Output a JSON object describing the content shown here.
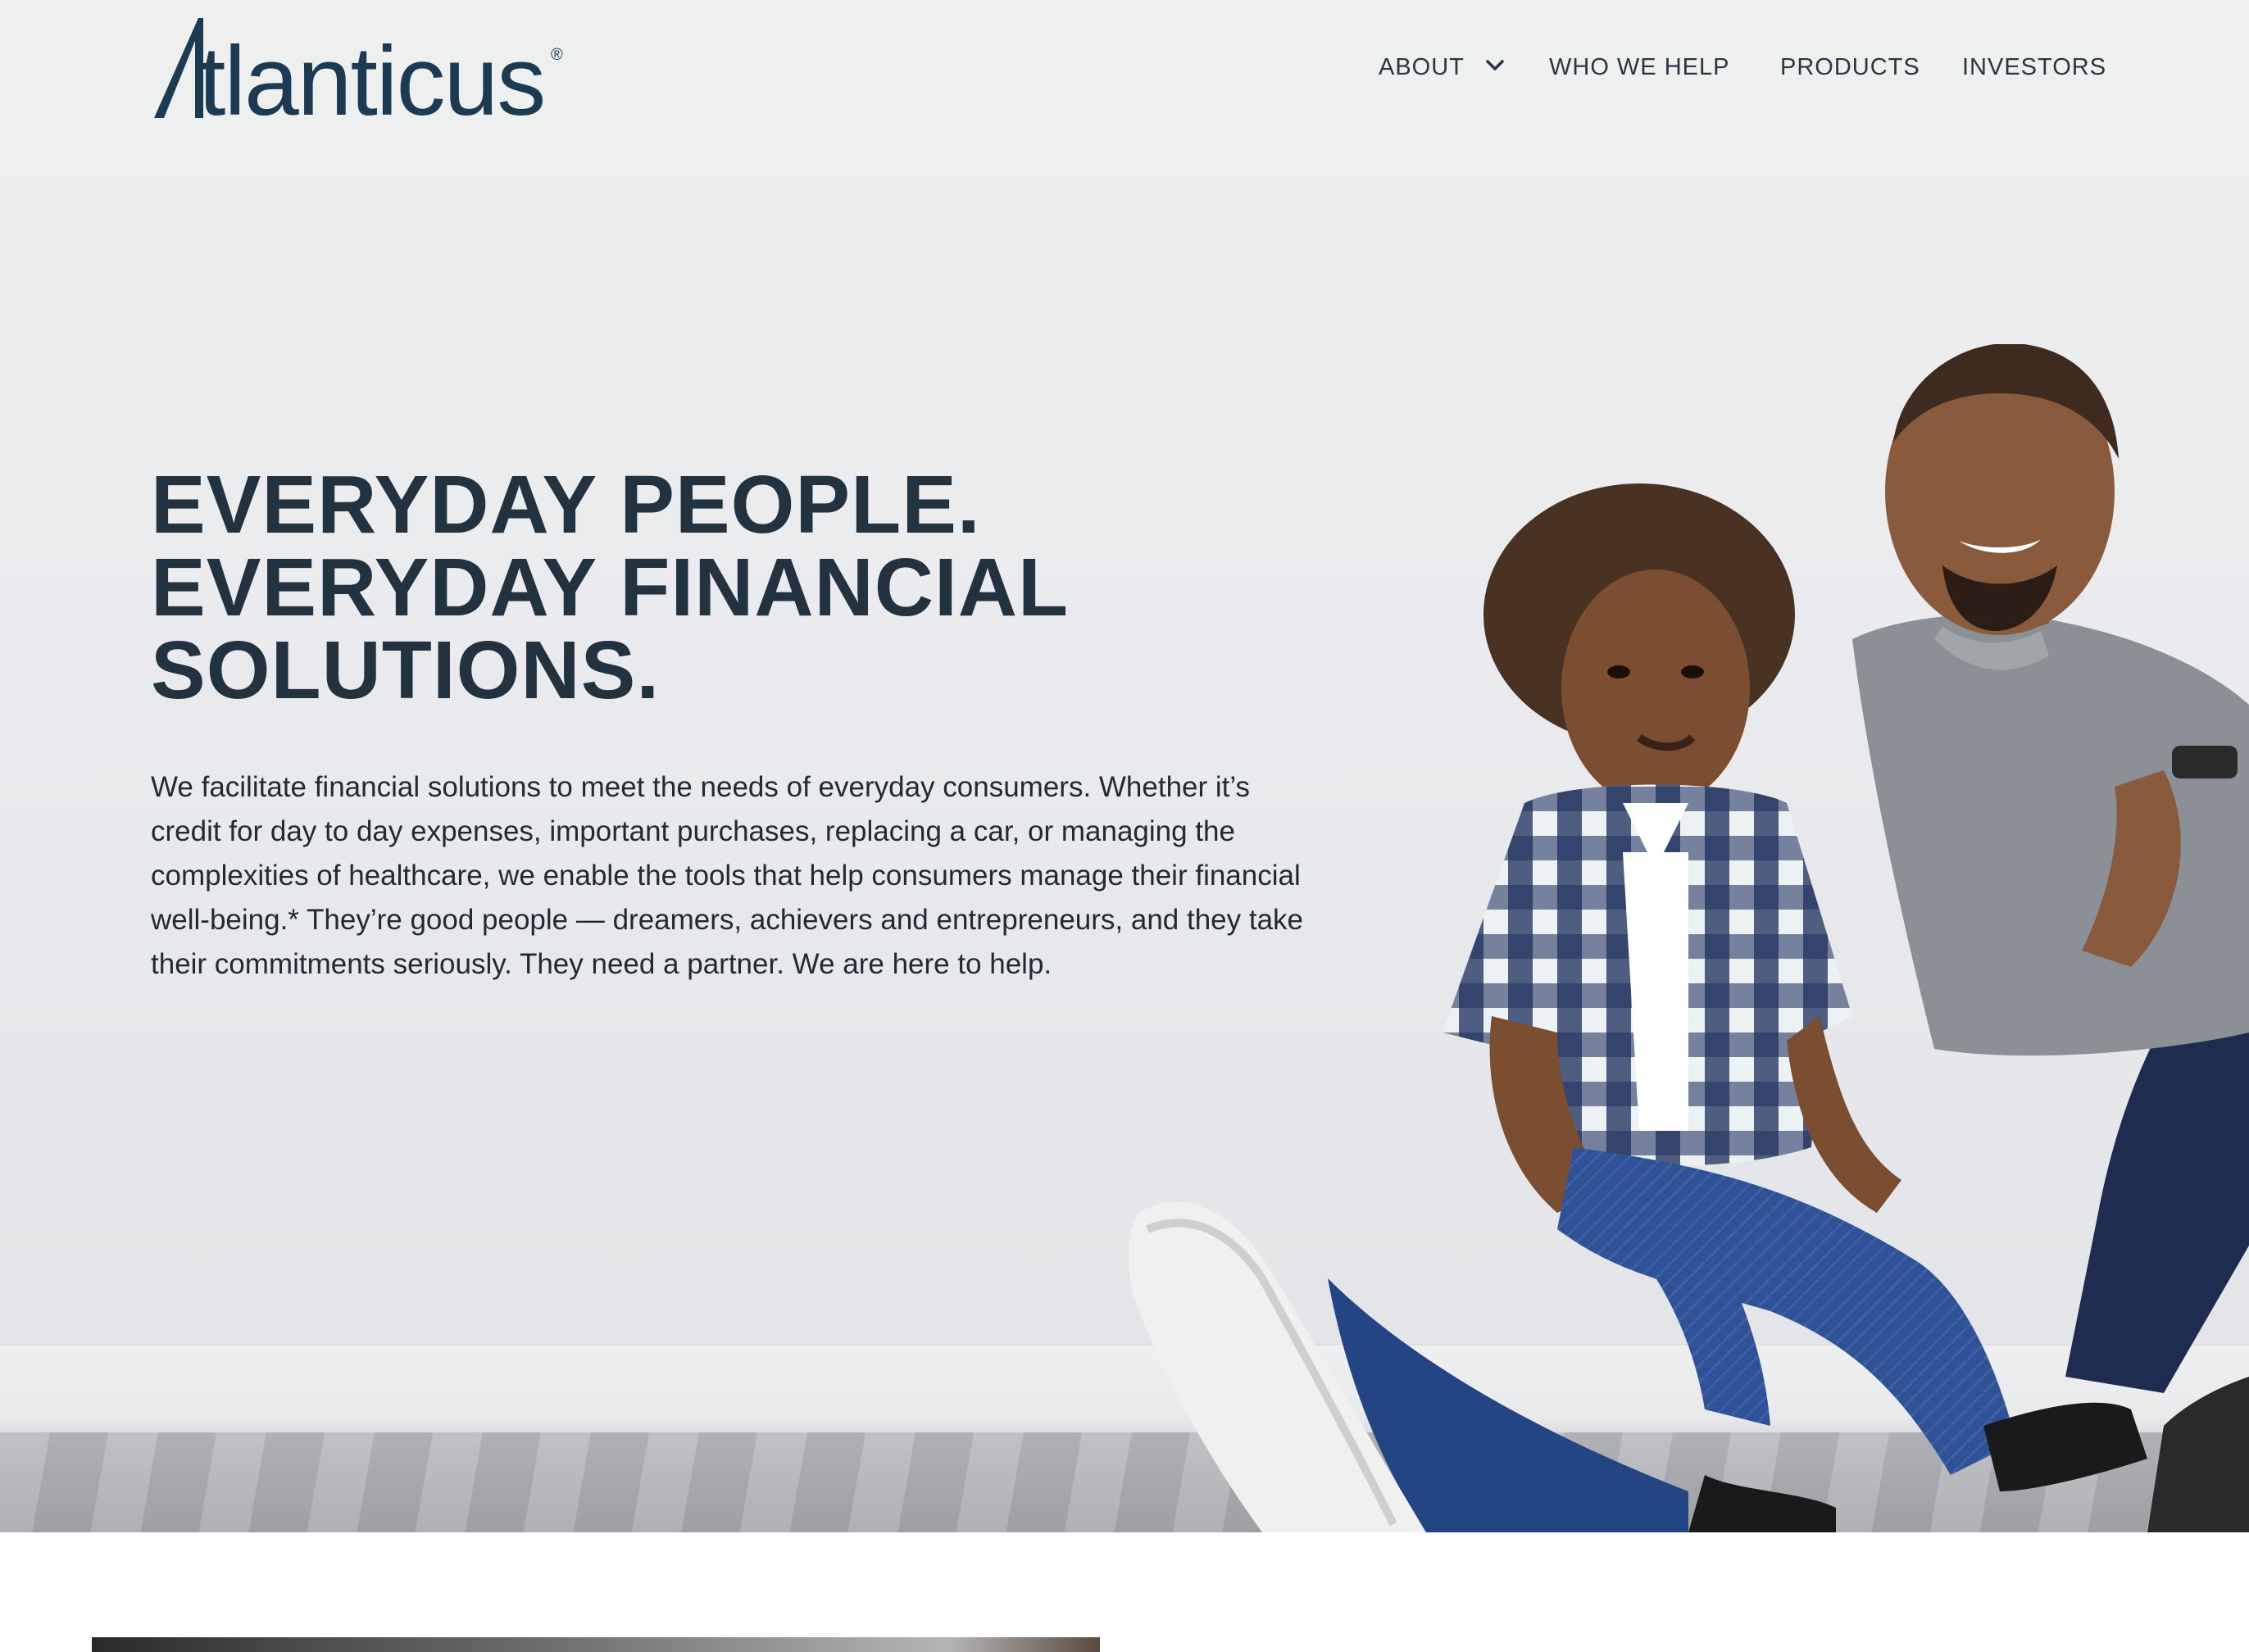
{
  "brand": {
    "name": "Atlanticus",
    "logo_text": "tlanticus",
    "registered_mark": "®",
    "color": "#1c3a52"
  },
  "nav": {
    "items": [
      {
        "label": "ABOUT",
        "has_dropdown": true
      },
      {
        "label": "WHO WE HELP",
        "has_dropdown": false
      },
      {
        "label": "PRODUCTS",
        "has_dropdown": false
      },
      {
        "label": "INVESTORS",
        "has_dropdown": false
      }
    ]
  },
  "hero": {
    "headline_lines": [
      "EVERYDAY PEOPLE.",
      "EVERYDAY FINANCIAL",
      "SOLUTIONS."
    ],
    "body": "We facilitate financial solutions to meet the needs of everyday consumers. Whether it’s credit for day to day expenses, important purchases, replacing a car, or managing the complexities of healthcare, we enable the tools that help consumers manage their financial well-being.* They’re good people — dreamers, achievers and entrepreneurs, and they take their commitments seriously. They need a partner. We are here to help.",
    "text_color": "#23323f"
  },
  "icons": {
    "about_dropdown": "chevron-down-icon"
  }
}
